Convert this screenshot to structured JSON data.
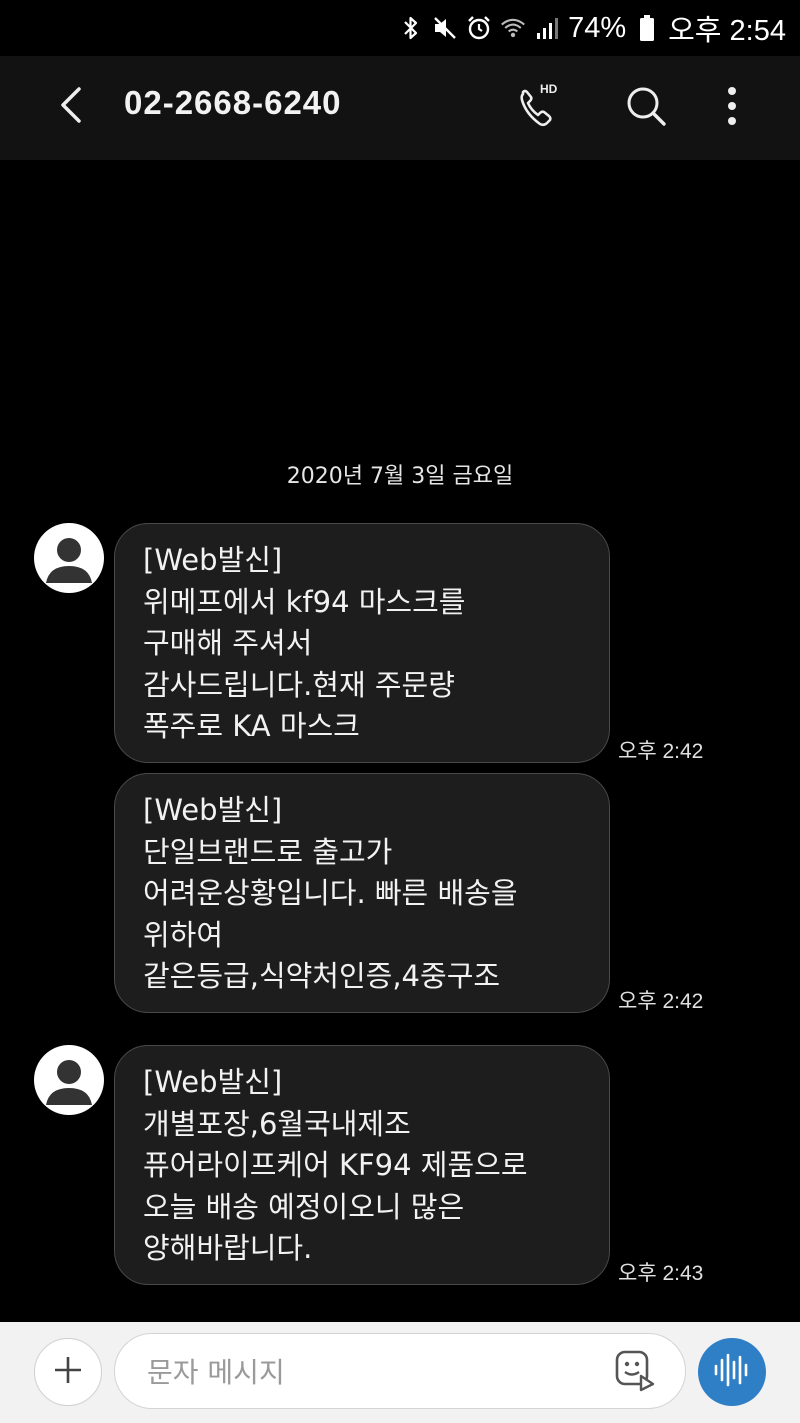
{
  "status_bar": {
    "battery": "74%",
    "time": "오후 2:54",
    "icons": [
      "bluetooth-icon",
      "mute-icon",
      "alarm-icon",
      "wifi-icon",
      "signal-icon",
      "battery-icon"
    ]
  },
  "header": {
    "title": "02-2668-6240",
    "call_badge": "HD",
    "icons": [
      "back-arrow-icon",
      "hd-call-icon",
      "search-icon",
      "more-vert-icon"
    ]
  },
  "conversation": {
    "date_separator": "2020년 7월 3일 금요일",
    "messages": [
      {
        "lines": [
          "[Web발신]",
          "위메프에서 kf94 마스크를",
          "구매해 주셔서",
          "감사드립니다.현재 주문량",
          "폭주로 KA 마스크"
        ],
        "time": "오후 2:42",
        "show_avatar": true
      },
      {
        "lines": [
          "[Web발신]",
          "단일브랜드로 출고가",
          "어려운상황입니다. 빠른 배송을",
          "위하여",
          "같은등급,식약처인증,4중구조"
        ],
        "time": "오후 2:42",
        "show_avatar": false
      },
      {
        "lines": [
          "[Web발신]",
          "개별포장,6월국내제조",
          "퓨어라이프케어 KF94 제품으로",
          "오늘 배송 예정이오니 많은",
          "양해바랍니다."
        ],
        "time": "오후 2:43",
        "show_avatar": true
      }
    ]
  },
  "composer": {
    "placeholder": "문자 메시지",
    "icons": [
      "plus-icon",
      "sticker-icon",
      "voice-input-icon"
    ]
  },
  "colors": {
    "background": "#000000",
    "appbar": "#121212",
    "bubble": "#1d1d1d",
    "bubble_border": "#4a4a4a",
    "composer_bg": "#f2f2f2",
    "voice_button": "#2f7fc6"
  }
}
